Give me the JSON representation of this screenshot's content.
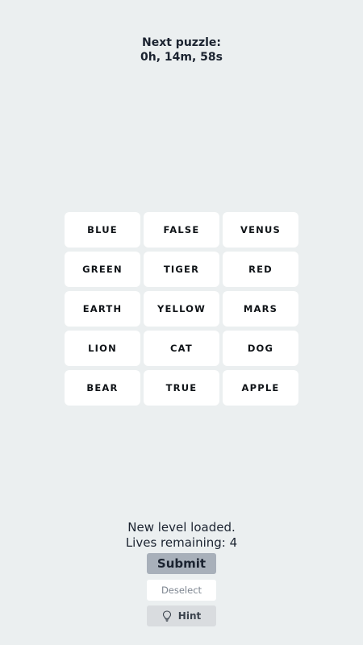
{
  "countdown": {
    "label": "Next puzzle:",
    "time": "0h, 14m, 58s"
  },
  "grid": {
    "tiles": [
      "BLUE",
      "FALSE",
      "VENUS",
      "GREEN",
      "TIGER",
      "RED",
      "EARTH",
      "YELLOW",
      "MARS",
      "LION",
      "CAT",
      "DOG",
      "BEAR",
      "TRUE",
      "APPLE"
    ]
  },
  "status": {
    "message": "New level loaded.",
    "lives": "Lives remaining: 4"
  },
  "buttons": {
    "submit": "Submit",
    "deselect": "Deselect",
    "hint": "Hint",
    "hint_icon": "lightbulb-icon"
  },
  "colors": {
    "background": "#ebeff0",
    "tile": "#ffffff",
    "submit": "#a8b0ba",
    "hint": "#d9dcdf"
  }
}
